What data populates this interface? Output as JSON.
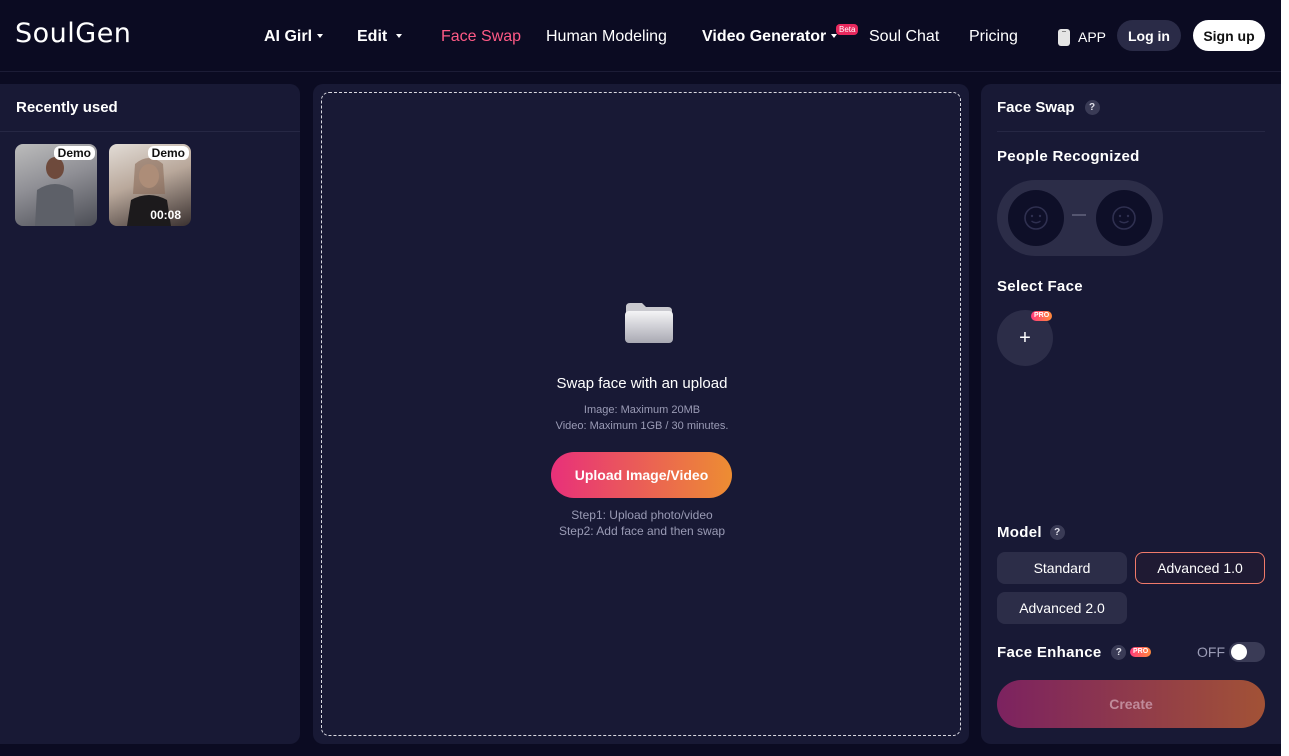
{
  "header": {
    "logo": "SoulGen",
    "nav": [
      {
        "label": "AI Girl"
      },
      {
        "label": "Edit"
      },
      {
        "label": "Face Swap"
      },
      {
        "label": "Human Modeling"
      },
      {
        "label": "Video Generator"
      },
      {
        "label": "Soul Chat"
      },
      {
        "label": "Pricing"
      }
    ],
    "beta_badge": "Beta",
    "app_label": "APP",
    "login_label": "Log in",
    "signup_label": "Sign up"
  },
  "recent": {
    "title": "Recently used",
    "items": [
      {
        "badge": "Demo",
        "duration": ""
      },
      {
        "badge": "Demo",
        "duration": "00:08"
      }
    ]
  },
  "upload": {
    "title": "Swap face with an upload",
    "hint_image": "Image: Maximum 20MB",
    "hint_video": "Video: Maximum 1GB / 30 minutes.",
    "button_label": "Upload Image/Video",
    "step1": "Step1: Upload photo/video",
    "step2": "Step2: Add face and then swap"
  },
  "settings": {
    "title": "Face Swap",
    "help": "?",
    "people_label": "People Recognized",
    "select_face_label": "Select Face",
    "add_symbol": "+",
    "pro_badge": "PRO",
    "model_label": "Model",
    "models": [
      {
        "label": "Standard",
        "selected": false
      },
      {
        "label": "Advanced 1.0",
        "selected": true
      },
      {
        "label": "Advanced 2.0",
        "selected": false
      }
    ],
    "face_enhance_label": "Face Enhance",
    "face_enhance_state": "OFF",
    "create_label": "Create"
  },
  "colors": {
    "background": "#0b0b22",
    "panel": "#181935",
    "accent_pink": "#e8307a",
    "accent_orange": "#ed8d32",
    "active_nav": "#ff5a86"
  },
  "icons": [
    "phone-icon",
    "folder-icon",
    "face-icon",
    "help-icon",
    "plus-icon",
    "caret-down-icon"
  ]
}
